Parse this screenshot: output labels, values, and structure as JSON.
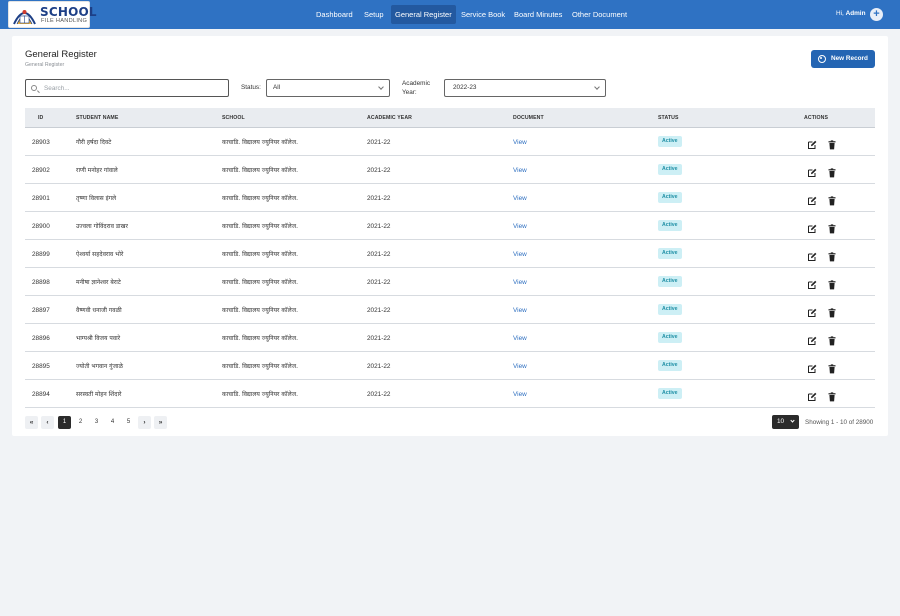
{
  "brand": {
    "title": "SCHOOL",
    "subtitle": "FILE HANDLING"
  },
  "nav": [
    "Dashboard",
    "Setup",
    "General Register",
    "Service Book",
    "Board Minutes",
    "Other Document"
  ],
  "active_nav": "General Register",
  "user": {
    "greeting": "Hi,",
    "name": "Admin"
  },
  "page": {
    "title": "General Register",
    "breadcrumb": "General Register",
    "new_record_label": "New Record"
  },
  "filters": {
    "search_placeholder": "Search...",
    "status_label": "Status:",
    "status_value": "All",
    "year_label_line1": "Academic",
    "year_label_line2": "Year:",
    "year_value": "2022-23"
  },
  "columns": [
    "ID",
    "STUDENT NAME",
    "SCHOOL",
    "ACADEMIC YEAR",
    "DOCUMENT",
    "STATUS",
    "ACTIONS"
  ],
  "rows": [
    {
      "id": "28903",
      "name": "गौरी हर्षदा दिवटे",
      "school": "काचाडि. विद्यालय ज्युनियर कॉलेज.",
      "year": "2021-22",
      "document": "View",
      "status": "Active"
    },
    {
      "id": "28902",
      "name": "राणी मनोहर गांवाले",
      "school": "काचाडि. विद्यालय ज्युनियर कॉलेज.",
      "year": "2021-22",
      "document": "View",
      "status": "Active"
    },
    {
      "id": "28901",
      "name": "तृष्णा विलास इंगले",
      "school": "काचाडि. विद्यालय ज्युनियर कॉलेज.",
      "year": "2021-22",
      "document": "View",
      "status": "Active"
    },
    {
      "id": "28900",
      "name": "उज्वला गोविंदराव डाखर",
      "school": "काचाडि. विद्यालय ज्युनियर कॉलेज.",
      "year": "2021-22",
      "document": "View",
      "status": "Active"
    },
    {
      "id": "28899",
      "name": "ऐश्वर्या सहदेवराव भोरे",
      "school": "काचाडि. विद्यालय ज्युनियर कॉलेज.",
      "year": "2021-22",
      "document": "View",
      "status": "Active"
    },
    {
      "id": "28898",
      "name": "मनीषा ज्ञानेश्वर बेराटे",
      "school": "काचाडि. विद्यालय ज्युनियर कॉलेज.",
      "year": "2021-22",
      "document": "View",
      "status": "Active"
    },
    {
      "id": "28897",
      "name": "वैष्णवी धनाजी गवळी",
      "school": "काचाडि. विद्यालय ज्युनियर कॉलेज.",
      "year": "2021-22",
      "document": "View",
      "status": "Active"
    },
    {
      "id": "28896",
      "name": "भाग्यश्री विजय पवारे",
      "school": "काचाडि. विद्यालय ज्युनियर कॉलेज.",
      "year": "2021-22",
      "document": "View",
      "status": "Active"
    },
    {
      "id": "28895",
      "name": "ज्योती भगवान गुंजाळे",
      "school": "काचाडि. विद्यालय ज्युनियर कॉलेज.",
      "year": "2021-22",
      "document": "View",
      "status": "Active"
    },
    {
      "id": "28894",
      "name": "सरस्वती मोहन शिंदारे",
      "school": "काचाडि. विद्यालय ज्युनियर कॉलेज.",
      "year": "2021-22",
      "document": "View",
      "status": "Active"
    }
  ],
  "pagination": {
    "first": "«",
    "prev": "‹",
    "next": "›",
    "last": "»",
    "pages": [
      "1",
      "2",
      "3",
      "4",
      "5"
    ],
    "current": "1",
    "per_page": "10",
    "showing": "Showing 1 - 10 of 28900"
  },
  "colors": {
    "primary": "#2f72c3",
    "active_badge_bg": "#cdeff5",
    "active_badge_text": "#1f8fa5",
    "link": "#2e6fc0"
  },
  "icons": {
    "edit": "edit-icon",
    "delete": "trash-icon",
    "search": "search-icon",
    "add": "plus-icon",
    "new_record": "record-icon"
  }
}
